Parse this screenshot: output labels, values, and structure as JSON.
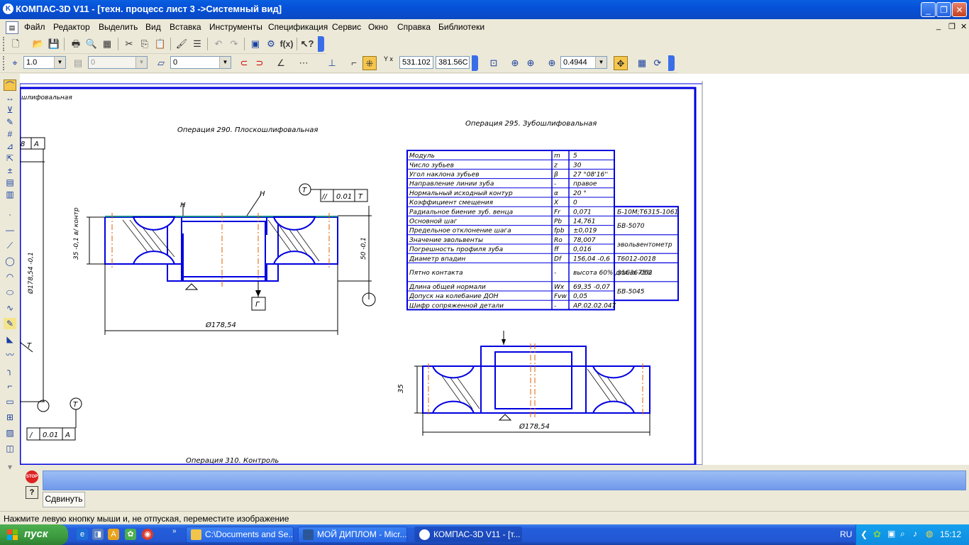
{
  "window": {
    "title": "КОМПАС-3D V11 - [техн. процесс лист 3 ->Системный вид]",
    "app_icon": "K"
  },
  "menu": [
    "Файл",
    "Редактор",
    "Выделить",
    "Вид",
    "Вставка",
    "Инструменты",
    "Спецификация",
    "Сервис",
    "Окно",
    "Справка",
    "Библиотеки"
  ],
  "toolbar2": {
    "scale": "1.0",
    "layer_disabled": "0",
    "style": "0",
    "coord_x": "531.102",
    "coord_y": "381.56C",
    "coord_label": "Y x",
    "zoom": "0.4944"
  },
  "drawing": {
    "op_header": "шлифовальная",
    "op290_title": "Операция 290. Плоскошлифовальная",
    "op295_title": "Операция 295. Зубошлифовальная",
    "op_bottom": "Операция 310. Контроль",
    "dim_diameter": "Ø178,54",
    "dim_diameter2": "Ø178,54",
    "dim_vert_left": "Ø178,54 -0,1",
    "dim_35": "35 -0,1 в/ контр",
    "dim_50": "50 -0,1",
    "dim_35b": "35",
    "label_H1": "Н",
    "label_H2": "Н",
    "label_G": "Г",
    "label_T": "Т",
    "label_A": "А",
    "label_8": "8",
    "tol_box": {
      "sym": "//",
      "val": "0.01",
      "base": "Т"
    },
    "tol_box2": {
      "sym": "/",
      "val": "0.01",
      "base": "А"
    },
    "table": [
      {
        "name": "Модуль",
        "sym": "m",
        "val": "5"
      },
      {
        "name": "Число зубьев",
        "sym": "z",
        "val": "30"
      },
      {
        "name": "Угол наклона зубьев",
        "sym": "β",
        "val": "27 °08'16''"
      },
      {
        "name": "Направление линии зуба",
        "sym": "-",
        "val": "правое"
      },
      {
        "name": "Нормальный исходный контур",
        "sym": "α",
        "val": "20 °"
      },
      {
        "name": "Коэффициент смещения",
        "sym": "X",
        "val": "0"
      },
      {
        "name": "Радиальное биение зуб. венца",
        "sym": "Fr",
        "val": "0,071"
      },
      {
        "name": "Основной шаг",
        "sym": "Pb",
        "val": "14,761"
      },
      {
        "name": "Предельное отклонение шага",
        "sym": "fpb",
        "val": "±0,019"
      },
      {
        "name": "Значение эвольвенты",
        "sym": "Ro",
        "val": "78,007"
      },
      {
        "name": "Погрешность профиля зуба",
        "sym": "ff",
        "val": "0,016"
      },
      {
        "name": "Диаметр впадин",
        "sym": "Df",
        "val": "156,04 -0,6"
      },
      {
        "name": "Пятно контакта",
        "sym": "-",
        "val": "высота 60% длина 75%"
      },
      {
        "name": "Длина общей нормали",
        "sym": "Wx",
        "val": "69,35 -0,07"
      },
      {
        "name": "Допуск на колебание ДОН",
        "sym": "Fvw",
        "val": "0,05"
      },
      {
        "name": "Шифр сопряженной детали",
        "sym": "-",
        "val": "АР.02.02.047"
      }
    ],
    "side_labels": [
      "Б-10М;Т6315-1061",
      "БВ-5070",
      "эвольвентометр",
      "Т6012-0018",
      "31С36-062",
      "БВ-5045"
    ]
  },
  "panel": {
    "stop_label": "STOP",
    "help_label": "?",
    "tab_label": "Сдвинуть"
  },
  "status": "Нажмите левую кнопку мыши и, не отпуская, переместите изображение",
  "taskbar": {
    "start": "пуск",
    "tasks": [
      "C:\\Documents and Se...",
      "МОЙ ДИПЛОМ - Micr...",
      "КОМПАС-3D V11 - [т..."
    ],
    "lang": "RU",
    "clock": "15:12"
  },
  "colors": {
    "accent_blue": "#0000e0",
    "titlebar": "#0a5fe0",
    "axis_orange": "#e06000"
  }
}
